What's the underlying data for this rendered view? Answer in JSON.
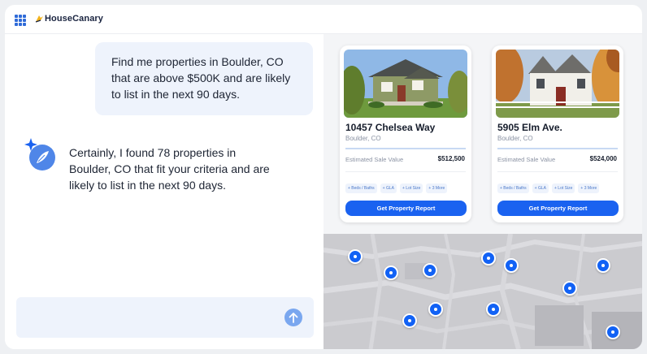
{
  "app": {
    "brand": "HouseCanary",
    "brand_color": "#2f6bd8"
  },
  "chat": {
    "user_message": "Find me properties in Boulder, CO that are above $500K and are likely to list in the next 90 days.",
    "assistant_message": "Certainly, I found 78 properties in Boulder, CO that fit your criteria and are likely to list in the next 90 days.",
    "composer_placeholder": "",
    "send_icon": "arrow-up-icon"
  },
  "cards": [
    {
      "address": "10457 Chelsea Way",
      "city": "Boulder, CO",
      "estimate_label": "Estimated Sale Value",
      "estimate_value": "$512,500",
      "chips": [
        "+ Beds / Baths",
        "+ GLA",
        "+ Lot Size",
        "+ 3 More"
      ],
      "cta": "Get Property Report"
    },
    {
      "address": "5905 Elm Ave.",
      "city": "Boulder, CO",
      "estimate_label": "Estimated Sale Value",
      "estimate_value": "$524,000",
      "chips": [
        "+ Beds / Baths",
        "+ GLA",
        "+ Lot Size",
        "+ 3 More"
      ],
      "cta": "Get Property Report"
    }
  ],
  "map": {
    "pin_color": "#1262f5",
    "pin_count": 11
  }
}
